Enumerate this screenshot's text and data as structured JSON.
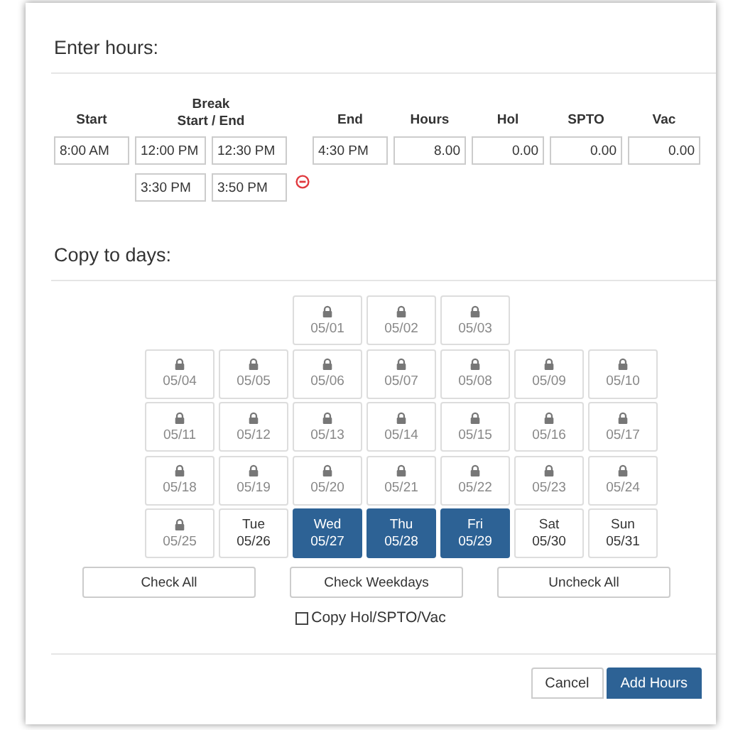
{
  "hours_section": {
    "title": "Enter hours:",
    "headers": {
      "start": "Start",
      "break_title": "Break",
      "break_sub": "Start / End",
      "end": "End",
      "hours": "Hours",
      "hol": "Hol",
      "spto": "SPTO",
      "vac": "Vac"
    },
    "main_row": {
      "start": "8:00 AM",
      "break_start": "12:00 PM",
      "break_end": "12:30 PM",
      "end": "4:30 PM",
      "hours": "8.00",
      "hol": "0.00",
      "spto": "0.00",
      "vac": "0.00"
    },
    "extra_breaks": [
      {
        "break_start": "3:30 PM",
        "break_end": "3:50 PM",
        "removable": true
      }
    ]
  },
  "copy_section": {
    "title": "Copy to days:",
    "weeks": [
      [
        {
          "kind": "blank"
        },
        {
          "kind": "blank"
        },
        {
          "kind": "locked",
          "date": "05/01"
        },
        {
          "kind": "locked",
          "date": "05/02"
        },
        {
          "kind": "locked",
          "date": "05/03"
        },
        {
          "kind": "blank"
        },
        {
          "kind": "blank"
        }
      ],
      [
        {
          "kind": "locked",
          "date": "05/04"
        },
        {
          "kind": "locked",
          "date": "05/05"
        },
        {
          "kind": "locked",
          "date": "05/06"
        },
        {
          "kind": "locked",
          "date": "05/07"
        },
        {
          "kind": "locked",
          "date": "05/08"
        },
        {
          "kind": "locked",
          "date": "05/09"
        },
        {
          "kind": "locked",
          "date": "05/10"
        }
      ],
      [
        {
          "kind": "locked",
          "date": "05/11"
        },
        {
          "kind": "locked",
          "date": "05/12"
        },
        {
          "kind": "locked",
          "date": "05/13"
        },
        {
          "kind": "locked",
          "date": "05/14"
        },
        {
          "kind": "locked",
          "date": "05/15"
        },
        {
          "kind": "locked",
          "date": "05/16"
        },
        {
          "kind": "locked",
          "date": "05/17"
        }
      ],
      [
        {
          "kind": "locked",
          "date": "05/18"
        },
        {
          "kind": "locked",
          "date": "05/19"
        },
        {
          "kind": "locked",
          "date": "05/20"
        },
        {
          "kind": "locked",
          "date": "05/21"
        },
        {
          "kind": "locked",
          "date": "05/22"
        },
        {
          "kind": "locked",
          "date": "05/23"
        },
        {
          "kind": "locked",
          "date": "05/24"
        }
      ],
      [
        {
          "kind": "locked",
          "date": "05/25"
        },
        {
          "kind": "open",
          "weekday": "Tue",
          "date": "05/26",
          "selected": false
        },
        {
          "kind": "open",
          "weekday": "Wed",
          "date": "05/27",
          "selected": true
        },
        {
          "kind": "open",
          "weekday": "Thu",
          "date": "05/28",
          "selected": true
        },
        {
          "kind": "open",
          "weekday": "Fri",
          "date": "05/29",
          "selected": true
        },
        {
          "kind": "open",
          "weekday": "Sat",
          "date": "05/30",
          "selected": false
        },
        {
          "kind": "open",
          "weekday": "Sun",
          "date": "05/31",
          "selected": false
        }
      ]
    ],
    "buttons": [
      "Check All",
      "Check Weekdays",
      "Uncheck All"
    ],
    "copy_option": {
      "label": "Copy Hol/SPTO/Vac",
      "checked": false
    }
  },
  "footer": {
    "cancel": "Cancel",
    "primary": "Add Hours"
  }
}
